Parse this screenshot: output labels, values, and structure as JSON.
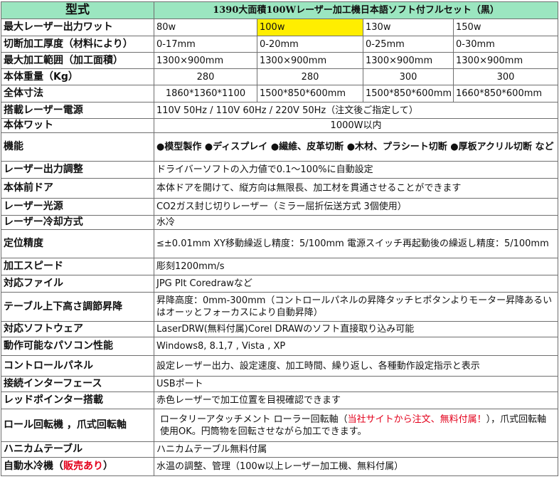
{
  "header": {
    "label": "型式",
    "title": "1390大面積100Wレーザー加工機日本語ソフト付フルセット（黒）"
  },
  "rows": {
    "power": {
      "label": "最大レーザー出力ワット",
      "values": [
        "80w",
        "100w",
        "130w",
        "150w"
      ]
    },
    "depth": {
      "label": "切断加工厚度（材料により）",
      "values": [
        "0-17mm",
        "0-20mm",
        "0-25mm",
        "0-30mm"
      ]
    },
    "area": {
      "label": "最大加工範囲（加工面積）",
      "values": [
        "1300×900mm",
        "1300×900mm",
        "1300×900mm",
        "1300×900mm"
      ]
    },
    "weight": {
      "label": "本体重量（Kg）",
      "values": [
        "280",
        "280",
        "300",
        "300"
      ]
    },
    "size": {
      "label": "全体寸法",
      "values": [
        "1860*1360*1100",
        "1500*850*600mm",
        "1500*850*600mm",
        "1660*850*600mm"
      ]
    },
    "psu": {
      "label": "搭載レーザー電源",
      "value": "110V 50Hz / 110V 60Hz / 220V 50Hz（注文後ご指定して）"
    },
    "watt": {
      "label": "本体ワット",
      "value": "1000W以内"
    },
    "function": {
      "label": "機能",
      "value": "●模型製作 ●ディスプレイ ●繊維、皮革切断 ●木材、プラシート切断 ●厚板アクリル切断 など"
    },
    "adjust": {
      "label": "レーザー出力調整",
      "value": "ドライバーソフトの入力値で0.1～100%に自動設定"
    },
    "door": {
      "label": "本体前ドア",
      "value": "本体ドアを開けて、縦方向は無限長、加工材を貫通させることができます"
    },
    "source": {
      "label": "レーザー光源",
      "value": "CO2ガス封じ切りレーザー（ミラー屈折伝送方式 3個使用）"
    },
    "cooling": {
      "label": "レーザー冷却方式",
      "value": "水冷"
    },
    "precision": {
      "label": "定位精度",
      "value": "≤±0.01mm XY移動繰返し精度：5/100mm 電源スイッチ再起動後の繰返し精度：5/100mm"
    },
    "speed": {
      "label": "加工スピード",
      "value": "彫刻1200mm/s"
    },
    "files": {
      "label": "対応ファイル",
      "value": "JPG Plt Coredrawなど"
    },
    "table_lift": {
      "label": "テーブル上下高さ調節昇降",
      "value": "昇降高度：0mm-300mm（コントロールパネルの昇降タッチヒポタンよりモーター昇降あるいはオーッとフォーカスにより自動昇降）"
    },
    "software": {
      "label": "対応ソフトウェア",
      "value": "LaserDRW(無料付属)Corel DRAWのソフト直接取り込み可能"
    },
    "pc": {
      "label": "動作可能なパソコン性能",
      "value": "Windows8, 8.1,7 , Vista , XP"
    },
    "panel": {
      "label": "コントロールパネル",
      "value": "設定レーザー出力、設定速度、加工時間、繰り返し、各種動作設定指示と表示"
    },
    "interface": {
      "label": "接続インターフェース",
      "value": "USBポート"
    },
    "pointer": {
      "label": "レッドポインター搭載",
      "value": "赤色レーザーで加工位置を目視確認できます"
    },
    "rotary": {
      "label": "ロール回転機 ，爪式回転軸",
      "value_1": "ロータリーアタッチメント ローラー回転軸（",
      "value_red": "当社サイトから注文、無料付属！",
      "value_2": "），爪式回転軸使用OK。円筒物を回転させながら加工できます。"
    },
    "honeycomb": {
      "label": "ハニカムテーブル",
      "value": "ハニカムテーブル無料付属"
    },
    "chiller": {
      "label_1": "自動水冷機（",
      "label_red": "販売あり",
      "label_2": "）",
      "value": "水温の調整、管理（100w以上レーザー加工機、無料付属）"
    }
  },
  "colors": {
    "header_bg": "#9be6c0",
    "highlight": "#ffee00",
    "accent_red": "#e3001b"
  }
}
